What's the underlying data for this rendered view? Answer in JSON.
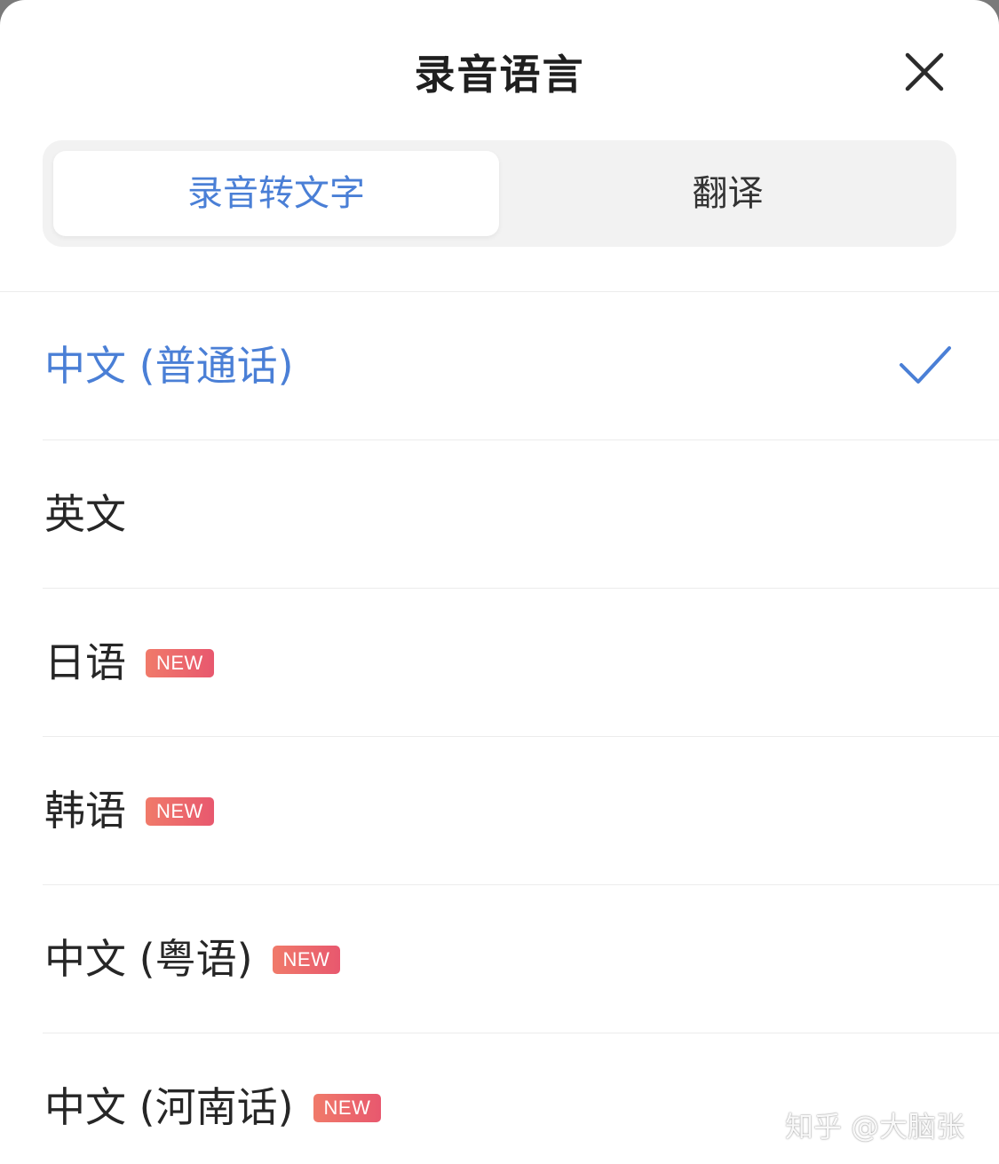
{
  "sheet": {
    "title": "录音语言"
  },
  "tabs": [
    {
      "label": "录音转文字",
      "active": true
    },
    {
      "label": "翻译",
      "active": false
    }
  ],
  "languages": [
    {
      "label": "中文 (普通话)",
      "selected": true,
      "badge": ""
    },
    {
      "label": "英文",
      "selected": false,
      "badge": ""
    },
    {
      "label": "日语",
      "selected": false,
      "badge": "NEW"
    },
    {
      "label": "韩语",
      "selected": false,
      "badge": "NEW"
    },
    {
      "label": "中文 (粤语)",
      "selected": false,
      "badge": "NEW"
    },
    {
      "label": "中文 (河南话)",
      "selected": false,
      "badge": "NEW"
    }
  ],
  "icons": {
    "close": "close-icon",
    "selected": "checkmark-icon"
  },
  "colors": {
    "accent": "#4a7fd6",
    "badge": "#e8586e"
  },
  "watermark": "知乎 @大脑张"
}
